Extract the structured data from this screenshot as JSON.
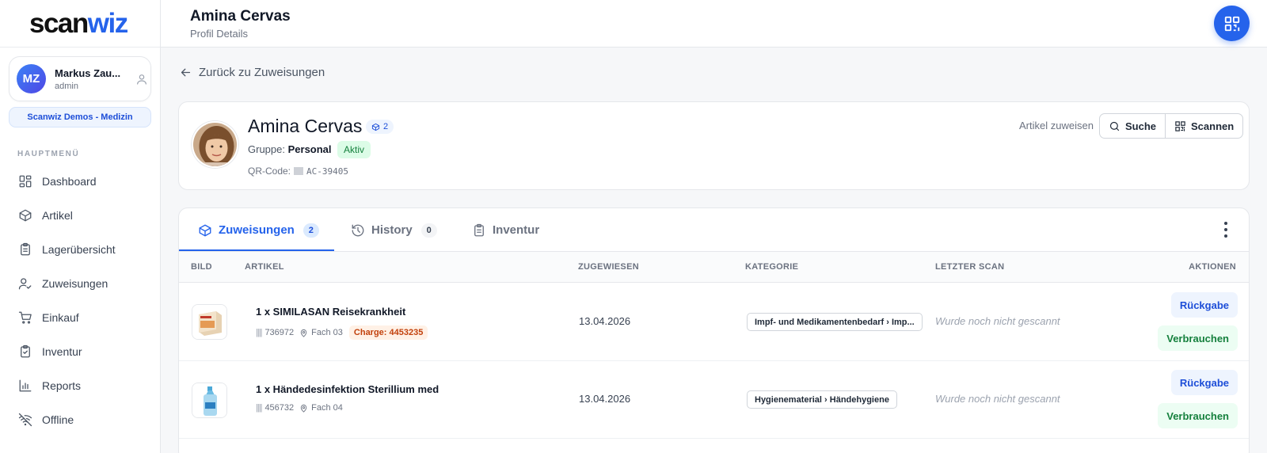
{
  "app": {
    "logo_scan": "scan",
    "logo_wiz": "wiz"
  },
  "user": {
    "initials": "MZ",
    "name": "Markus Zau...",
    "role": "admin",
    "org": "Scanwiz Demos - Medizin"
  },
  "sidebar": {
    "section_label": "HAUPTMENÜ",
    "items": [
      {
        "label": "Dashboard",
        "icon": "dashboard-icon"
      },
      {
        "label": "Artikel",
        "icon": "box-icon"
      },
      {
        "label": "Lagerübersicht",
        "icon": "clipboard-icon"
      },
      {
        "label": "Zuweisungen",
        "icon": "user-check-icon"
      },
      {
        "label": "Einkauf",
        "icon": "cart-icon"
      },
      {
        "label": "Inventur",
        "icon": "clipboard-check-icon"
      },
      {
        "label": "Reports",
        "icon": "bar-chart-icon"
      },
      {
        "label": "Offline",
        "icon": "wifi-off-icon"
      }
    ]
  },
  "header": {
    "title": "Amina Cervas",
    "subtitle": "Profil Details"
  },
  "back_link": "Zurück zu Zuweisungen",
  "profile": {
    "name": "Amina Cervas",
    "item_count": "2",
    "group_label": "Gruppe:",
    "group_value": "Personal",
    "status": "Aktiv",
    "qr_label": "QR-Code:",
    "qr_code": "AC-39405",
    "assign_label": "Artikel zuweisen",
    "search_button": "Suche",
    "scan_button": "Scannen"
  },
  "tabs": [
    {
      "label": "Zuweisungen",
      "count": "2",
      "active": true
    },
    {
      "label": "History",
      "count": "0",
      "active": false
    },
    {
      "label": "Inventur",
      "count": "",
      "active": false
    }
  ],
  "table": {
    "columns": [
      "BILD",
      "ARTIKEL",
      "ZUGEWIESEN",
      "KATEGORIE",
      "LETZTER SCAN",
      "AKTIONEN"
    ],
    "rows": [
      {
        "title": "1 x SIMILASAN Reisekrankheit",
        "barcode": "736972",
        "location": "Fach 03",
        "charge": "Charge: 4453235",
        "assigned": "13.04.2026",
        "category": "Impf- und Medikamentenbedarf › Imp...",
        "last_scan": "Wurde noch nicht gescannt",
        "return_label": "Rückgabe",
        "use_label": "Verbrauchen"
      },
      {
        "title": "1 x Händedesinfektion Sterillium med",
        "barcode": "456732",
        "location": "Fach 04",
        "charge": "",
        "assigned": "13.04.2026",
        "category": "Hygienematerial › Händehygiene",
        "last_scan": "Wurde noch nicht gescannt",
        "return_label": "Rückgabe",
        "use_label": "Verbrauchen"
      }
    ]
  },
  "colors": {
    "accent": "#2563eb",
    "active_badge": "#15803d",
    "charge": "#c2410c"
  }
}
